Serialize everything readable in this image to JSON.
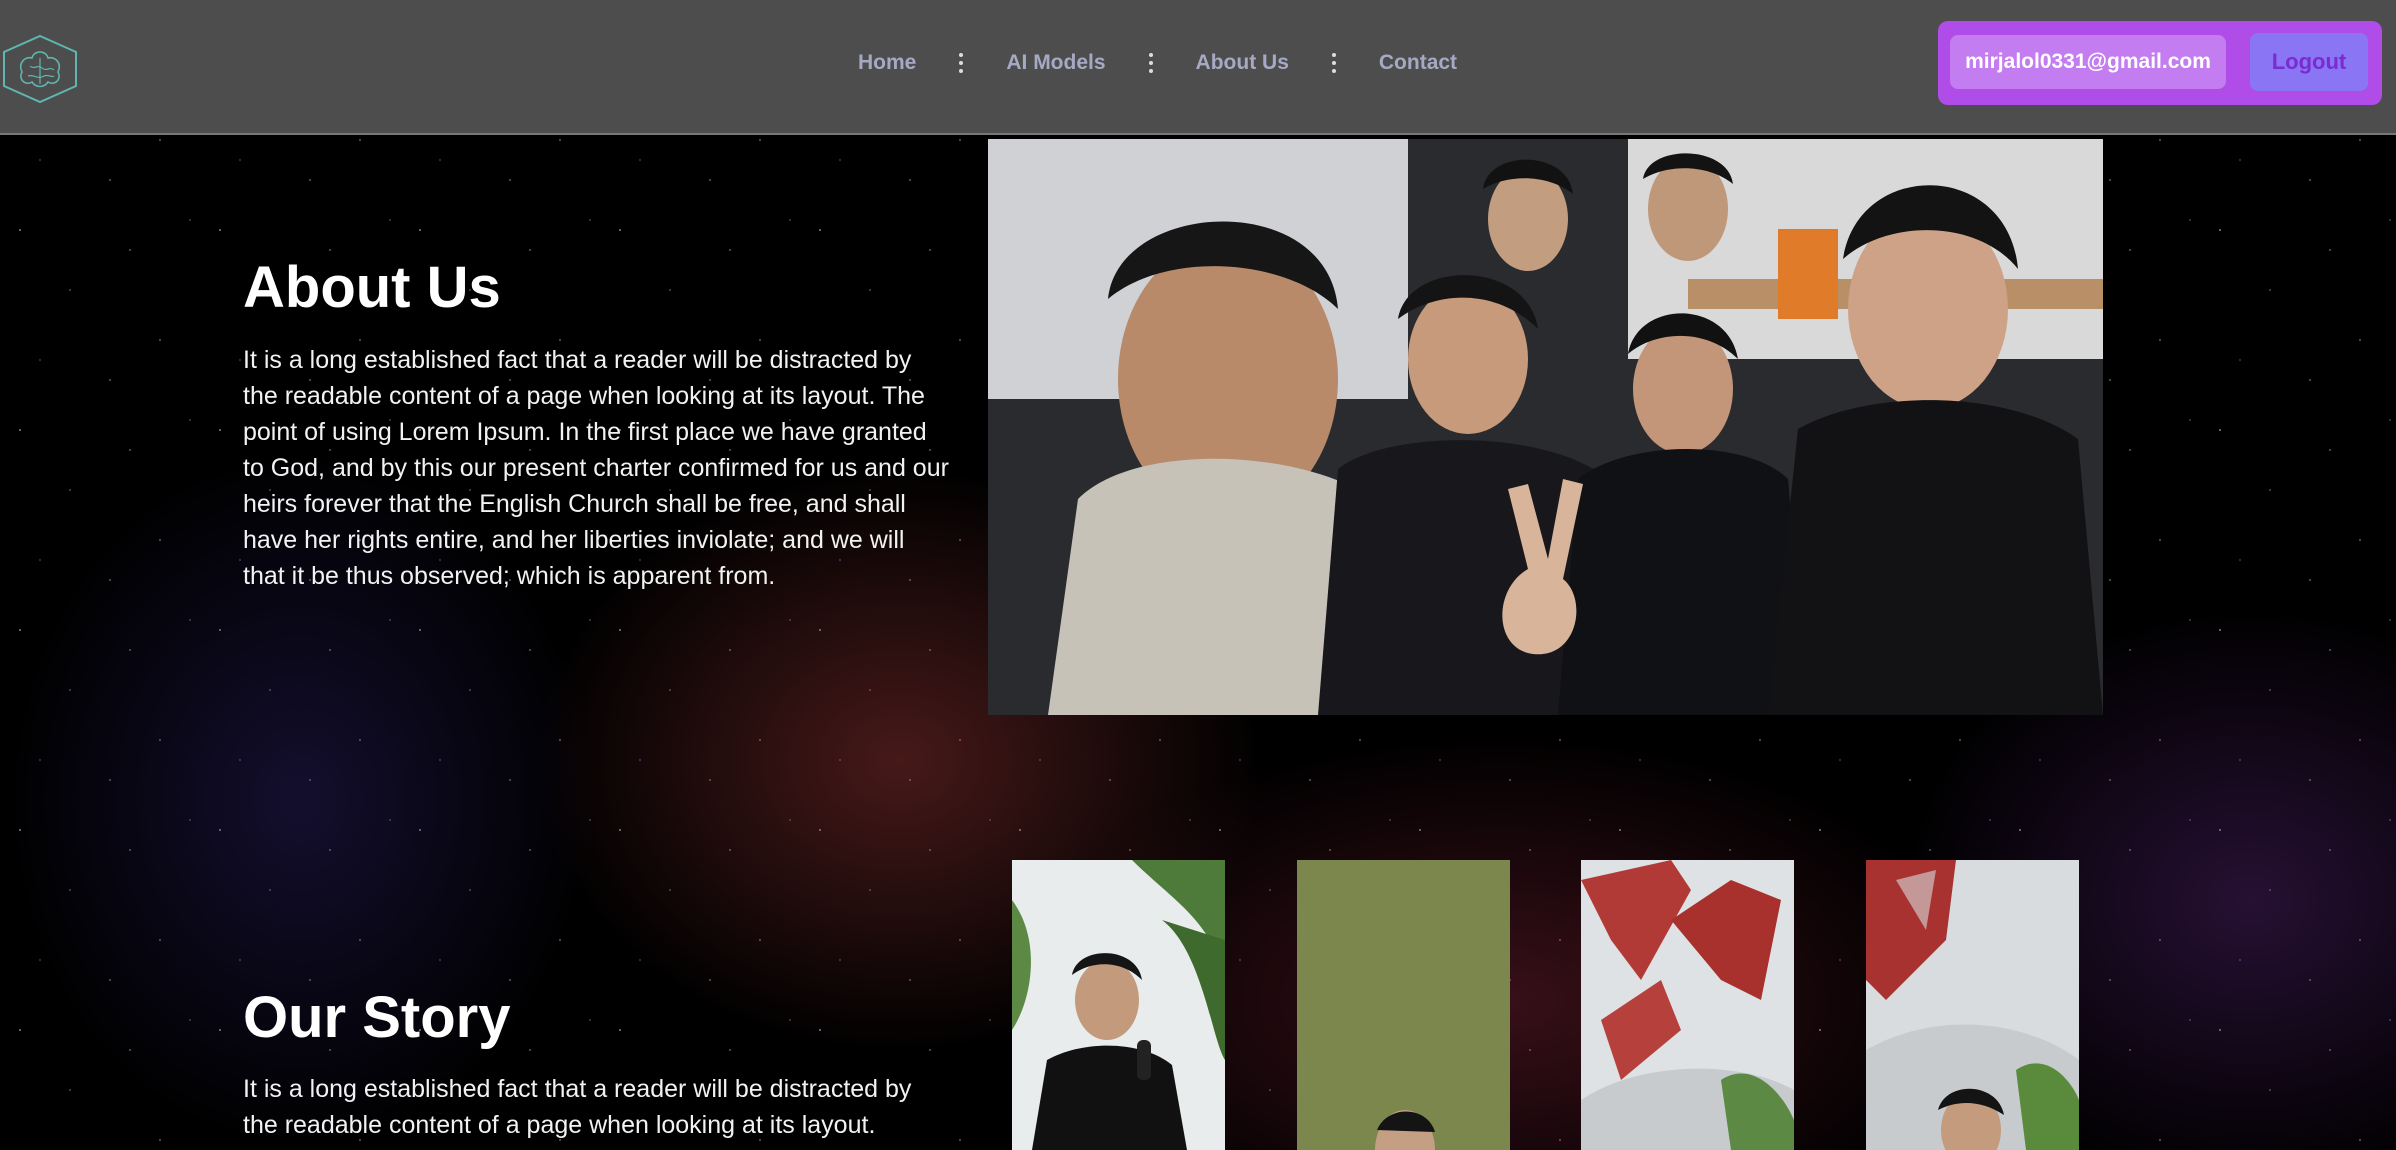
{
  "nav": {
    "links": [
      "Home",
      "AI Models",
      "About Us",
      "Contact"
    ]
  },
  "account": {
    "email": "mirjalol0331@gmail.com",
    "logout_label": "Logout"
  },
  "about": {
    "title": "About Us",
    "text": "It is a long established fact that a reader will be distracted by the readable content of a page when looking at its layout. The point of using Lorem Ipsum. In the first place we have granted to God, and by this our present charter confirmed for us and our heirs forever that the English Church shall be free, and shall have her rights entire, and her liberties inviolate; and we will that it be thus observed; which is apparent from."
  },
  "story": {
    "title": "Our Story",
    "text": "It is a long established fact that a reader will be distracted by the readable content of a page when looking at its layout."
  },
  "colors": {
    "navbar": "#4d4d4d",
    "account_bg": "#b04ce8",
    "logout_text": "#7b2bd0"
  },
  "icons": [
    "brain-logo-icon",
    "vertical-dots-separator-icon"
  ]
}
